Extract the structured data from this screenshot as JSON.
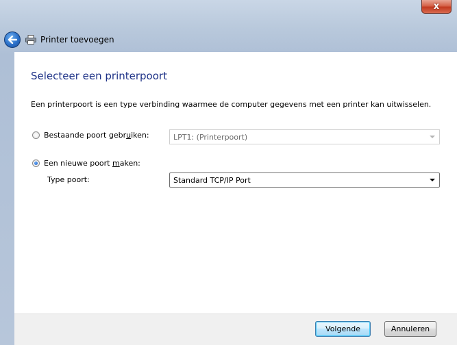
{
  "window": {
    "title": "Printer toevoegen",
    "close_label": "x"
  },
  "page": {
    "heading": "Selecteer een printerpoort",
    "description": "Een printerpoort is een type verbinding waarmee de computer gegevens met een printer kan uitwisselen."
  },
  "options": {
    "existing": {
      "label_pre": "Bestaande poort gebr",
      "label_accel": "u",
      "label_post": "iken:",
      "checked": false,
      "select_value": "LPT1: (Printerpoort)"
    },
    "new": {
      "label_pre": "Een nieuwe poort ",
      "label_accel": "m",
      "label_post": "aken:",
      "checked": true,
      "type_label": "Type poort:",
      "select_value": "Standard TCP/IP Port"
    }
  },
  "buttons": {
    "next": "Volgende",
    "cancel": "Annuleren"
  },
  "icons": {
    "back": "back-arrow-icon",
    "printer": "printer-icon",
    "close": "close-icon"
  },
  "colors": {
    "heading": "#1e3287",
    "close_button": "#c2391f",
    "back_button": "#2a6fc8"
  }
}
